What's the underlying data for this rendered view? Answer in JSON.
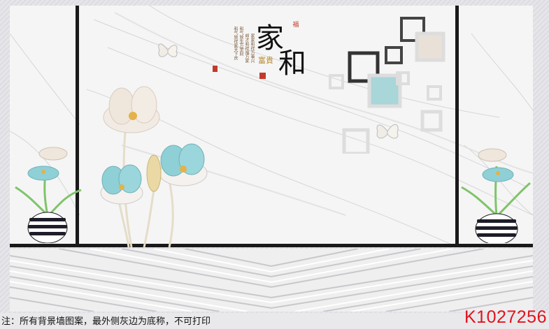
{
  "calligraphy": {
    "char1": "家",
    "char2": "和",
    "fu": "福"
  },
  "gold_text": "富貴",
  "poem": [
    "和气致祥家天下庆",
    "和气致生万里财",
    "郎才和祥福万家",
    "家家和祥万事兴"
  ],
  "caption": "注：所有背景墙图案，最外侧灰边为底称，不可打印",
  "product_code": "K1027256",
  "colors": {
    "border_grey": "#e2e2e6",
    "code_red": "#e2141c",
    "frame_black": "#1a1a1a",
    "flower_teal": "#8fd0d6"
  }
}
